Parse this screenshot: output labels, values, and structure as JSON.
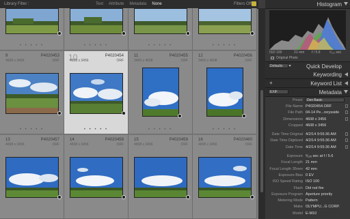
{
  "filter_bar": {
    "label": "Library Filter :",
    "tabs": [
      "Text",
      "Attribute",
      "Metadata",
      "None"
    ],
    "active_tab": "None",
    "filters_off": "Filters Off"
  },
  "grid": {
    "top_row": [
      {
        "num": "",
        "file": "",
        "dims": "",
        "ext": ""
      },
      {
        "num": "",
        "file": "",
        "dims": "",
        "ext": ""
      },
      {
        "num": "",
        "file": "",
        "dims": "",
        "ext": ""
      },
      {
        "num": "",
        "file": "",
        "dims": "",
        "ext": ""
      }
    ],
    "mid_row": [
      {
        "num": "9",
        "file": "P4020453",
        "dims": "4608 x 3456",
        "ext": "ORF"
      },
      {
        "num": "10",
        "file": "P4020454",
        "dims": "4608 x 3456",
        "ext": "ORF"
      },
      {
        "num": "11",
        "file": "P4020455",
        "dims": "3456 x 4608",
        "ext": "ORF"
      },
      {
        "num": "12",
        "file": "P4020456",
        "dims": "3456 x 4608",
        "ext": "ORF"
      }
    ],
    "bottom_row": [
      {
        "num": "13",
        "file": "P4020457",
        "dims": "4608 x 3456",
        "ext": "ORF"
      },
      {
        "num": "14",
        "file": "P4020458",
        "dims": "4608 x 3456",
        "ext": "ORF"
      },
      {
        "num": "15",
        "file": "P4020459",
        "dims": "4608 x 3456",
        "ext": "ORF"
      },
      {
        "num": "16",
        "file": "P4020460",
        "dims": "4608 x 3456",
        "ext": "ORF"
      }
    ]
  },
  "panels": {
    "histogram": "Histogram",
    "hist_iso": "ISO 100",
    "hist_focal": "21 mm",
    "hist_aperture": "f / 5.6",
    "hist_shutter": "¹⁄₁₂₅ sec",
    "original_photo": "Original Photo",
    "saved_preset": "Defaults",
    "quick_develop": "Quick Develop",
    "keywording": "Keywording",
    "keyword_list": "Keyword List",
    "metadata": "Metadata",
    "exif": "EXIF",
    "preset_label": "Preset",
    "preset_value": "Dex Basic"
  },
  "metadata": [
    {
      "k": "File Name",
      "v": "P4020454.ORF"
    },
    {
      "k": "File Path",
      "v": "04-14 Pe...rerysside"
    },
    {
      "k": "Dimensions",
      "v": "4608 x 3456"
    },
    {
      "k": "Cropped",
      "v": "4608 x 3456"
    },
    {
      "k": "",
      "v": ""
    },
    {
      "k": "Date Time Original",
      "v": "4/2/14 9:55:36 AM"
    },
    {
      "k": "Date Time Digitized",
      "v": "4/2/14 9:55:36 AM"
    },
    {
      "k": "Date Time",
      "v": "4/2/14 9:55:36 AM"
    },
    {
      "k": "",
      "v": ""
    },
    {
      "k": "Exposure",
      "v": "¹⁄₁₂₅ sec at f / 5.6"
    },
    {
      "k": "Focal Length",
      "v": "21 mm"
    },
    {
      "k": "Focal Length 35mm",
      "v": "42 mm"
    },
    {
      "k": "Exposure Bias",
      "v": "0 EV"
    },
    {
      "k": "ISO Speed Rating",
      "v": "ISO 100"
    },
    {
      "k": "Flash",
      "v": "Did not fire"
    },
    {
      "k": "Exposure Program",
      "v": "Aperture priority"
    },
    {
      "k": "Metering Mode",
      "v": "Pattern"
    },
    {
      "k": "Make",
      "v": "OLYMPU...G CORP."
    },
    {
      "k": "Model",
      "v": "E-M10"
    }
  ],
  "colors": {
    "accent": "#c8b33a",
    "grid_bg": "#7a7a7a",
    "selected": "#d8d8d8"
  }
}
